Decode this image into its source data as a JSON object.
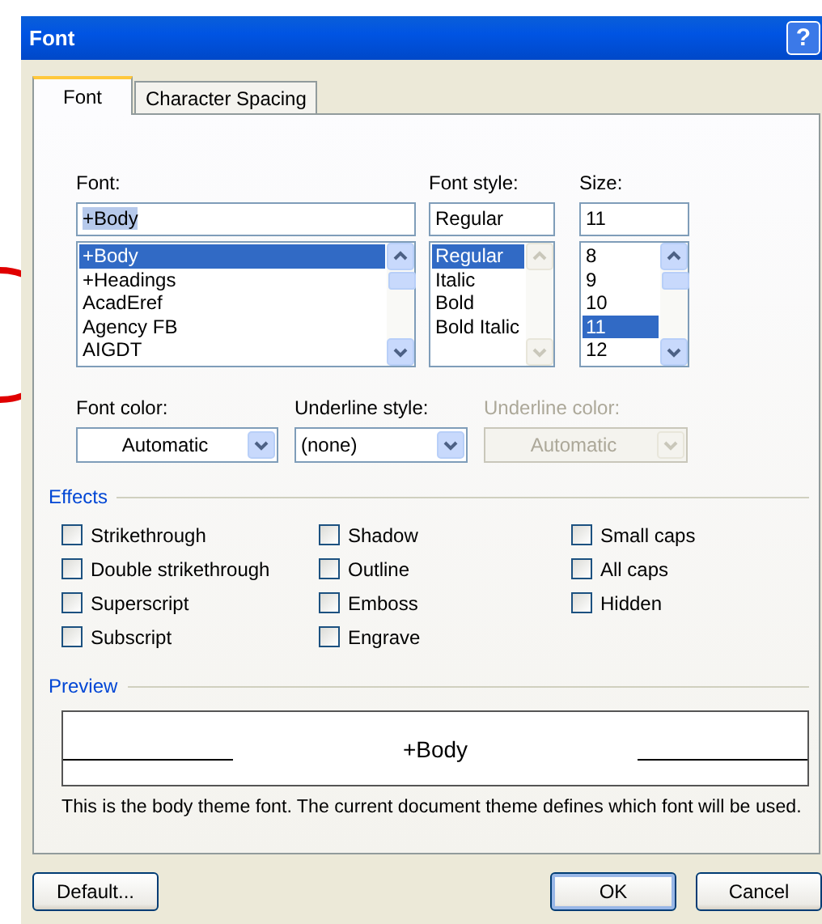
{
  "window": {
    "title": "Font",
    "help": "?"
  },
  "tabs": [
    {
      "label": "Font",
      "selected": true
    },
    {
      "label": "Character Spacing",
      "selected": false
    }
  ],
  "lists": [
    {
      "label": "Font:",
      "value": "+Body",
      "scrollbar_disabled": false,
      "items": [
        {
          "label": "+Body",
          "selected": true
        },
        {
          "label": "+Headings",
          "selected": false
        },
        {
          "label": "AcadEref",
          "selected": false
        },
        {
          "label": "Agency FB",
          "selected": false
        },
        {
          "label": "AIGDT",
          "selected": false
        }
      ]
    },
    {
      "label": "Font style:",
      "value": "Regular",
      "scrollbar_disabled": true,
      "items": [
        {
          "label": "Regular",
          "selected": true
        },
        {
          "label": "Italic",
          "selected": false
        },
        {
          "label": "Bold",
          "selected": false
        },
        {
          "label": "Bold Italic",
          "selected": false
        }
      ]
    },
    {
      "label": "Size:",
      "value": "11",
      "scrollbar_disabled": false,
      "items": [
        {
          "label": "8",
          "selected": false
        },
        {
          "label": "9",
          "selected": false
        },
        {
          "label": "10",
          "selected": false
        },
        {
          "label": "11",
          "selected": true
        },
        {
          "label": "12",
          "selected": false
        }
      ]
    }
  ],
  "dropdowns": [
    {
      "label": "Font color:",
      "value": "Automatic",
      "disabled": false
    },
    {
      "label": "Underline style:",
      "value": "(none)",
      "disabled": false
    },
    {
      "label": "Underline color:",
      "value": "Automatic",
      "disabled": true
    }
  ],
  "effects": {
    "title": "Effects",
    "columns": [
      [
        {
          "label": "Strikethrough",
          "checked": false
        },
        {
          "label": "Double strikethrough",
          "checked": false
        },
        {
          "label": "Superscript",
          "checked": false
        },
        {
          "label": "Subscript",
          "checked": false
        }
      ],
      [
        {
          "label": "Shadow",
          "checked": false
        },
        {
          "label": "Outline",
          "checked": false
        },
        {
          "label": "Emboss",
          "checked": false
        },
        {
          "label": "Engrave",
          "checked": false
        }
      ],
      [
        {
          "label": "Small caps",
          "checked": false
        },
        {
          "label": "All caps",
          "checked": false
        },
        {
          "label": "Hidden",
          "checked": false
        }
      ]
    ]
  },
  "preview": {
    "title": "Preview",
    "sample": "+Body",
    "description": "This is the body theme font. The current document theme defines which font will be used."
  },
  "buttons": [
    {
      "label": "Default...",
      "kind": "left"
    },
    {
      "label": "OK",
      "kind": "primary"
    },
    {
      "label": "Cancel",
      "kind": "normal"
    }
  ]
}
